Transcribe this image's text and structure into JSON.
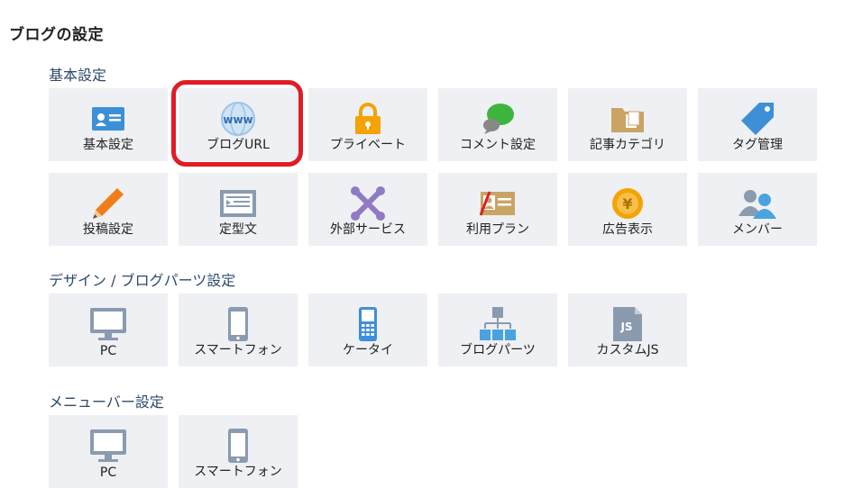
{
  "page_title": "ブログの設定",
  "sections": [
    {
      "title": "基本設定",
      "tiles": [
        {
          "label": "基本設定",
          "icon": "profile-card-icon"
        },
        {
          "label": "ブログURL",
          "icon": "www-globe-icon"
        },
        {
          "label": "プライベート",
          "icon": "padlock-icon"
        },
        {
          "label": "コメント設定",
          "icon": "speech-bubble-icon"
        },
        {
          "label": "記事カテゴリ",
          "icon": "folder-icon"
        },
        {
          "label": "タグ管理",
          "icon": "tag-icon"
        },
        {
          "label": "投稿設定",
          "icon": "pencil-icon"
        },
        {
          "label": "定型文",
          "icon": "template-icon"
        },
        {
          "label": "外部サービス",
          "icon": "joomla-icon"
        },
        {
          "label": "利用プラン",
          "icon": "plan-card-icon"
        },
        {
          "label": "広告表示",
          "icon": "yen-coin-icon"
        },
        {
          "label": "メンバー",
          "icon": "members-icon"
        }
      ]
    },
    {
      "title": "デザイン / ブログパーツ設定",
      "tiles": [
        {
          "label": "PC",
          "icon": "monitor-icon"
        },
        {
          "label": "スマートフォン",
          "icon": "smartphone-icon"
        },
        {
          "label": "ケータイ",
          "icon": "feature-phone-icon"
        },
        {
          "label": "ブログパーツ",
          "icon": "blog-parts-icon"
        },
        {
          "label": "カスタムJS",
          "icon": "js-file-icon"
        }
      ]
    },
    {
      "title": "メニューバー設定",
      "tiles": [
        {
          "label": "PC",
          "icon": "monitor-icon"
        },
        {
          "label": "スマートフォン",
          "icon": "smartphone-icon"
        }
      ]
    }
  ],
  "colors": {
    "tile_bg": "#eef0f3",
    "section_title": "#2c4a6b",
    "highlight": "#e01c24",
    "icon_blue": "#4a90d9"
  }
}
